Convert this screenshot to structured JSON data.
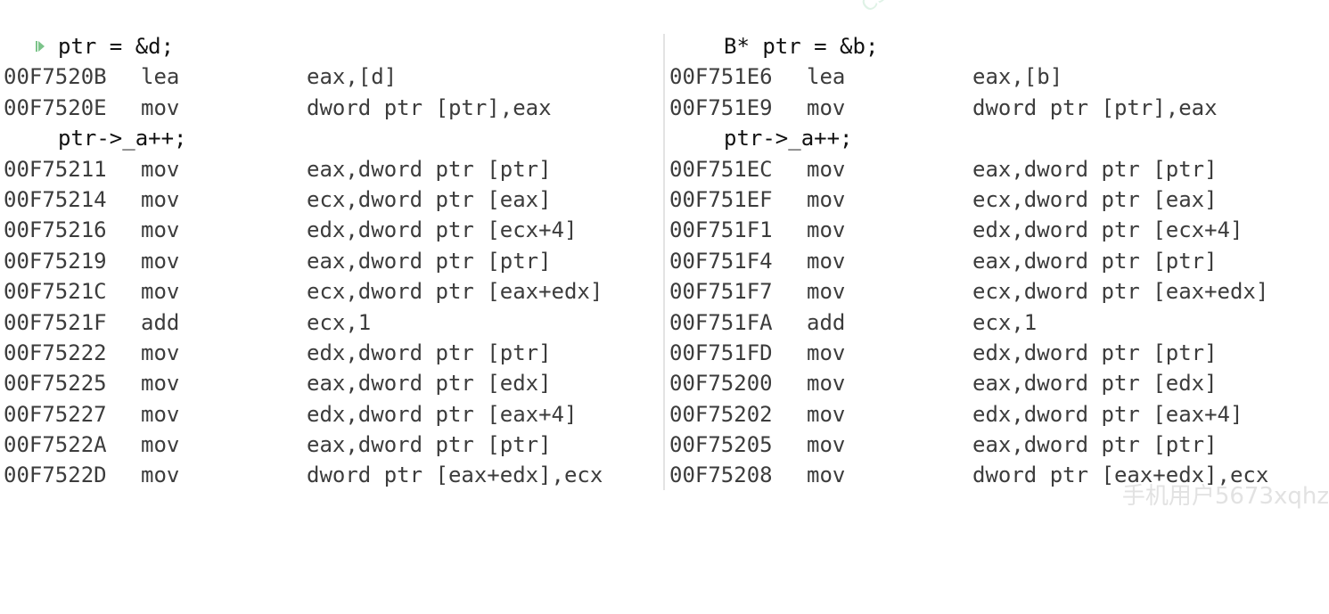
{
  "left_panel": {
    "source_line_1": "ptr = &d;",
    "instr_1": {
      "addr": "00F7520B",
      "mnemonic": "lea",
      "operands": "eax,[d]"
    },
    "instr_2": {
      "addr": "00F7520E",
      "mnemonic": "mov",
      "operands": "dword ptr [ptr],eax"
    },
    "source_line_2": "ptr->_a++;",
    "instr_3": {
      "addr": "00F75211",
      "mnemonic": "mov",
      "operands": "eax,dword ptr [ptr]"
    },
    "instr_4": {
      "addr": "00F75214",
      "mnemonic": "mov",
      "operands": "ecx,dword ptr [eax]"
    },
    "instr_5": {
      "addr": "00F75216",
      "mnemonic": "mov",
      "operands": "edx,dword ptr [ecx+4]"
    },
    "instr_6": {
      "addr": "00F75219",
      "mnemonic": "mov",
      "operands": "eax,dword ptr [ptr]"
    },
    "instr_7": {
      "addr": "00F7521C",
      "mnemonic": "mov",
      "operands": "ecx,dword ptr [eax+edx]"
    },
    "instr_8": {
      "addr": "00F7521F",
      "mnemonic": "add",
      "operands": "ecx,1"
    },
    "instr_9": {
      "addr": "00F75222",
      "mnemonic": "mov",
      "operands": "edx,dword ptr [ptr]"
    },
    "instr_10": {
      "addr": "00F75225",
      "mnemonic": "mov",
      "operands": "eax,dword ptr [edx]"
    },
    "instr_11": {
      "addr": "00F75227",
      "mnemonic": "mov",
      "operands": "edx,dword ptr [eax+4]"
    },
    "instr_12": {
      "addr": "00F7522A",
      "mnemonic": "mov",
      "operands": "eax,dword ptr [ptr]"
    },
    "instr_13": {
      "addr": "00F7522D",
      "mnemonic": "mov",
      "operands": "dword ptr [eax+edx],ecx"
    }
  },
  "right_panel": {
    "source_line_1": "B* ptr = &b;",
    "instr_1": {
      "addr": "00F751E6",
      "mnemonic": "lea",
      "operands": "eax,[b]"
    },
    "instr_2": {
      "addr": "00F751E9",
      "mnemonic": "mov",
      "operands": "dword ptr [ptr],eax"
    },
    "source_line_2": "ptr->_a++;",
    "instr_3": {
      "addr": "00F751EC",
      "mnemonic": "mov",
      "operands": "eax,dword ptr [ptr]"
    },
    "instr_4": {
      "addr": "00F751EF",
      "mnemonic": "mov",
      "operands": "ecx,dword ptr [eax]"
    },
    "instr_5": {
      "addr": "00F751F1",
      "mnemonic": "mov",
      "operands": "edx,dword ptr [ecx+4]"
    },
    "instr_6": {
      "addr": "00F751F4",
      "mnemonic": "mov",
      "operands": "eax,dword ptr [ptr]"
    },
    "instr_7": {
      "addr": "00F751F7",
      "mnemonic": "mov",
      "operands": "ecx,dword ptr [eax+edx]"
    },
    "instr_8": {
      "addr": "00F751FA",
      "mnemonic": "add",
      "operands": "ecx,1"
    },
    "instr_9": {
      "addr": "00F751FD",
      "mnemonic": "mov",
      "operands": "edx,dword ptr [ptr]"
    },
    "instr_10": {
      "addr": "00F75200",
      "mnemonic": "mov",
      "operands": "eax,dword ptr [edx]"
    },
    "instr_11": {
      "addr": "00F75202",
      "mnemonic": "mov",
      "operands": "edx,dword ptr [eax+4]"
    },
    "instr_12": {
      "addr": "00F75205",
      "mnemonic": "mov",
      "operands": "eax,dword ptr [ptr]"
    },
    "instr_13": {
      "addr": "00F75208",
      "mnemonic": "mov",
      "operands": "dword ptr [eax+edx],ecx"
    }
  },
  "watermark_bottom": "手机用户5673xqhz",
  "watermark_top": "CSD",
  "icons": {
    "current_line_marker": "play-arrow-icon"
  },
  "colors": {
    "current_line_marker": "#7cc48a",
    "text": "#3c3c3c",
    "divider": "#e3e3e3"
  }
}
